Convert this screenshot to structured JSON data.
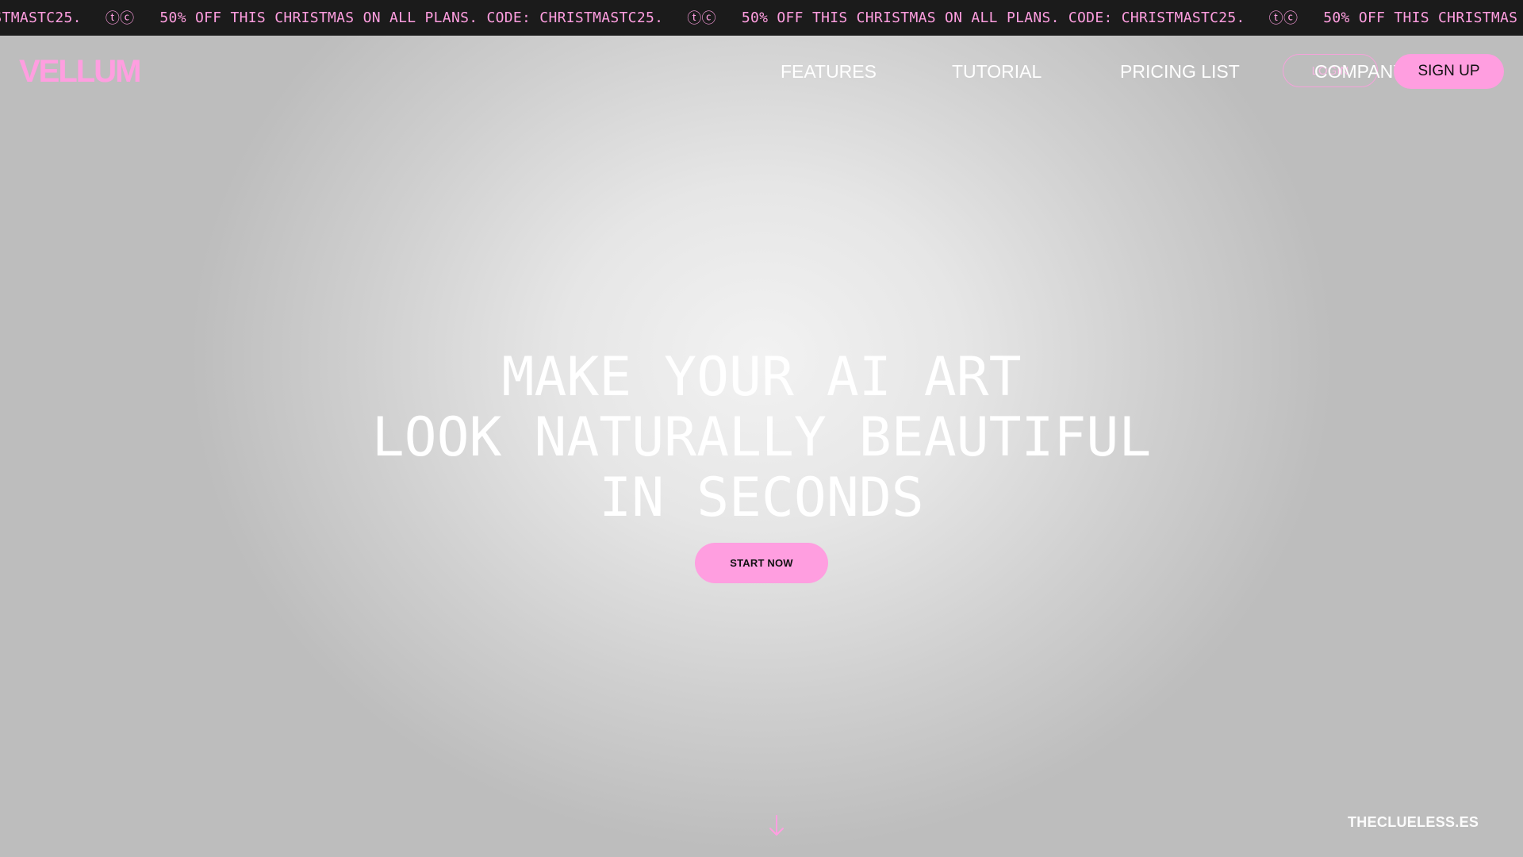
{
  "promo": {
    "text": "50% OFF THIS CHRISTMAS ON ALL PLANS. CODE: CHRISTMASTC25.",
    "glyph": "ⓣⓒ",
    "color": "#ff9ee0"
  },
  "header": {
    "logo": "VELLUM",
    "nav": [
      {
        "label": "FEATURES"
      },
      {
        "label": "TUTORIAL"
      },
      {
        "label": "PRICING LIST"
      },
      {
        "label": "COMPANY"
      }
    ],
    "login_label": "LOGIN",
    "signup_label": "SIGN UP"
  },
  "hero": {
    "title_lines": [
      "MAKE YOUR AI ART",
      "LOOK NATURALLY BEAUTIFUL",
      "IN SECONDS"
    ],
    "cta_label": "START NOW"
  },
  "footer": {
    "credit": "THECLUELESS.ES",
    "scroll_icon": "arrow-down-icon"
  },
  "colors": {
    "accent": "#ff9ee0",
    "ticker_bg": "#1b1b1b",
    "text_light": "#ffffff"
  }
}
